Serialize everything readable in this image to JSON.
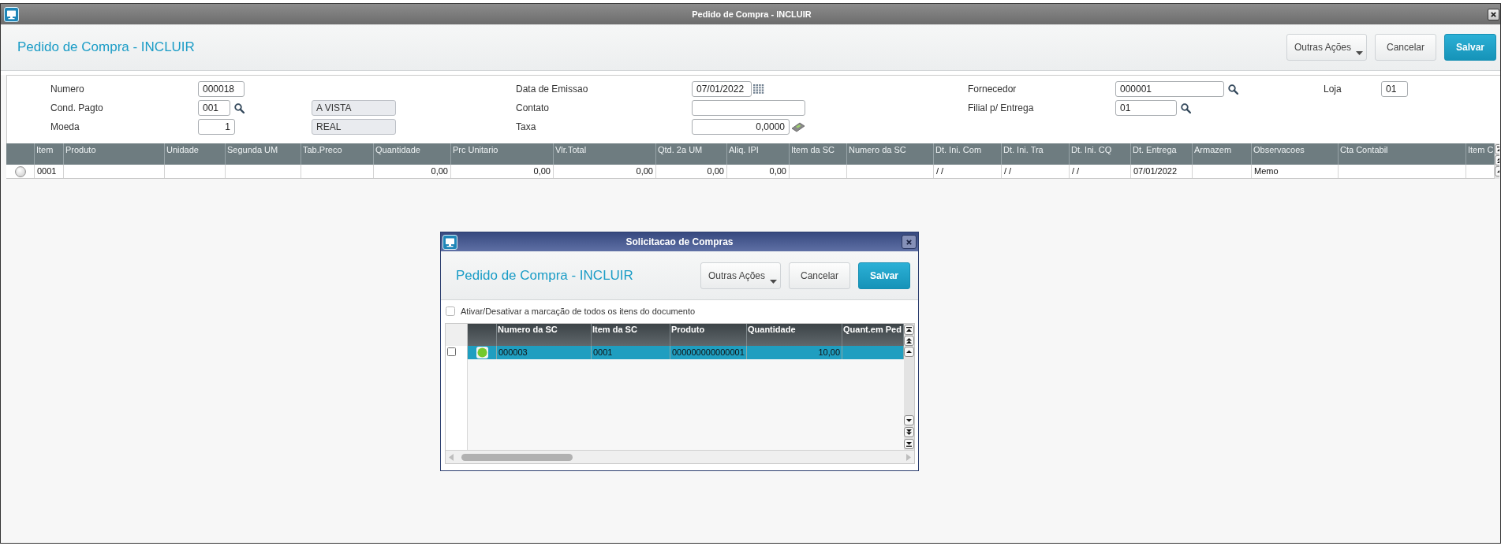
{
  "window": {
    "title": "Pedido de Compra - INCLUIR"
  },
  "header": {
    "title": "Pedido de Compra - INCLUIR",
    "buttons": [
      {
        "label": "Outras Ações",
        "kind": "menu"
      },
      {
        "label": "Cancelar",
        "kind": "secondary"
      },
      {
        "label": "Salvar",
        "kind": "primary"
      }
    ]
  },
  "form": {
    "rows": [
      [
        {
          "label": "Numero",
          "value": "000018",
          "kind": "text"
        },
        {
          "label": "Data de Emissao",
          "value": "07/01/2022",
          "kind": "date"
        },
        {
          "label": "Fornecedor",
          "value": "000001",
          "kind": "lookup"
        },
        {
          "label": "Loja",
          "value": "01",
          "kind": "text"
        }
      ],
      [
        {
          "label": "Cond. Pagto",
          "value": "001",
          "kind": "lookup",
          "description": "A VISTA"
        },
        {
          "label": "Contato",
          "kind": "text"
        },
        {
          "label": "Filial p/ Entrega",
          "value": "01",
          "kind": "lookup"
        }
      ],
      [
        {
          "label": "Moeda",
          "value": "1",
          "kind": "number",
          "description": "REAL"
        },
        {
          "label": "Taxa",
          "value": "0,0000",
          "kind": "calc"
        }
      ]
    ]
  },
  "grid": {
    "columns": [
      {
        "label": "Item",
        "kind": "text"
      },
      {
        "label": "Produto"
      },
      {
        "label": "Unidade"
      },
      {
        "label": "Segunda UM"
      },
      {
        "label": "Tab.Preco"
      },
      {
        "label": "Quantidade",
        "kind": "number"
      },
      {
        "label": "Prc Unitario",
        "kind": "number"
      },
      {
        "label": "Vlr.Total",
        "kind": "number"
      },
      {
        "label": "Qtd. 2a UM",
        "kind": "number"
      },
      {
        "label": "Aliq. IPI",
        "kind": "number"
      },
      {
        "label": "Item da SC"
      },
      {
        "label": "Numero da SC"
      },
      {
        "label": "Dt. Ini. Com",
        "kind": "text"
      },
      {
        "label": "Dt. Ini. Tra",
        "kind": "text"
      },
      {
        "label": "Dt. Ini. CQ",
        "kind": "text"
      },
      {
        "label": "Dt. Entrega",
        "kind": "text"
      },
      {
        "label": "Armazem"
      },
      {
        "label": "Observacoes",
        "kind": "text"
      },
      {
        "label": "Cta Contabil"
      },
      {
        "label": "Item C"
      }
    ],
    "rows": [
      {
        "selected": false,
        "cells": [
          "0001",
          null,
          null,
          null,
          null,
          "0,00",
          "0,00",
          "0,00",
          "0,00",
          "0,00",
          null,
          null,
          "/ /",
          "/ /",
          "/ /",
          "07/01/2022",
          null,
          "Memo",
          null,
          null
        ]
      }
    ]
  },
  "dialog": {
    "title": "Solicitacao de Compras",
    "header": {
      "title": "Pedido de Compra - INCLUIR",
      "buttons": [
        {
          "label": "Outras Ações",
          "kind": "menu"
        },
        {
          "label": "Cancelar",
          "kind": "secondary"
        },
        {
          "label": "Salvar",
          "kind": "primary"
        }
      ]
    },
    "select_all": {
      "label": "Ativar/Desativar a marcação de todos os itens do documento",
      "checked": false
    },
    "grid": {
      "columns": [
        {
          "label": "Numero da SC",
          "kind": "text"
        },
        {
          "label": "Item da SC",
          "kind": "text"
        },
        {
          "label": "Produto",
          "kind": "text"
        },
        {
          "label": "Quantidade",
          "kind": "number"
        },
        {
          "label": "Quant.em Ped"
        }
      ],
      "rows": [
        {
          "selected": true,
          "checked": false,
          "color": "#73c92d",
          "cells": [
            "000003",
            "0001",
            "000000000000001",
            "10,00",
            null
          ]
        }
      ]
    }
  }
}
